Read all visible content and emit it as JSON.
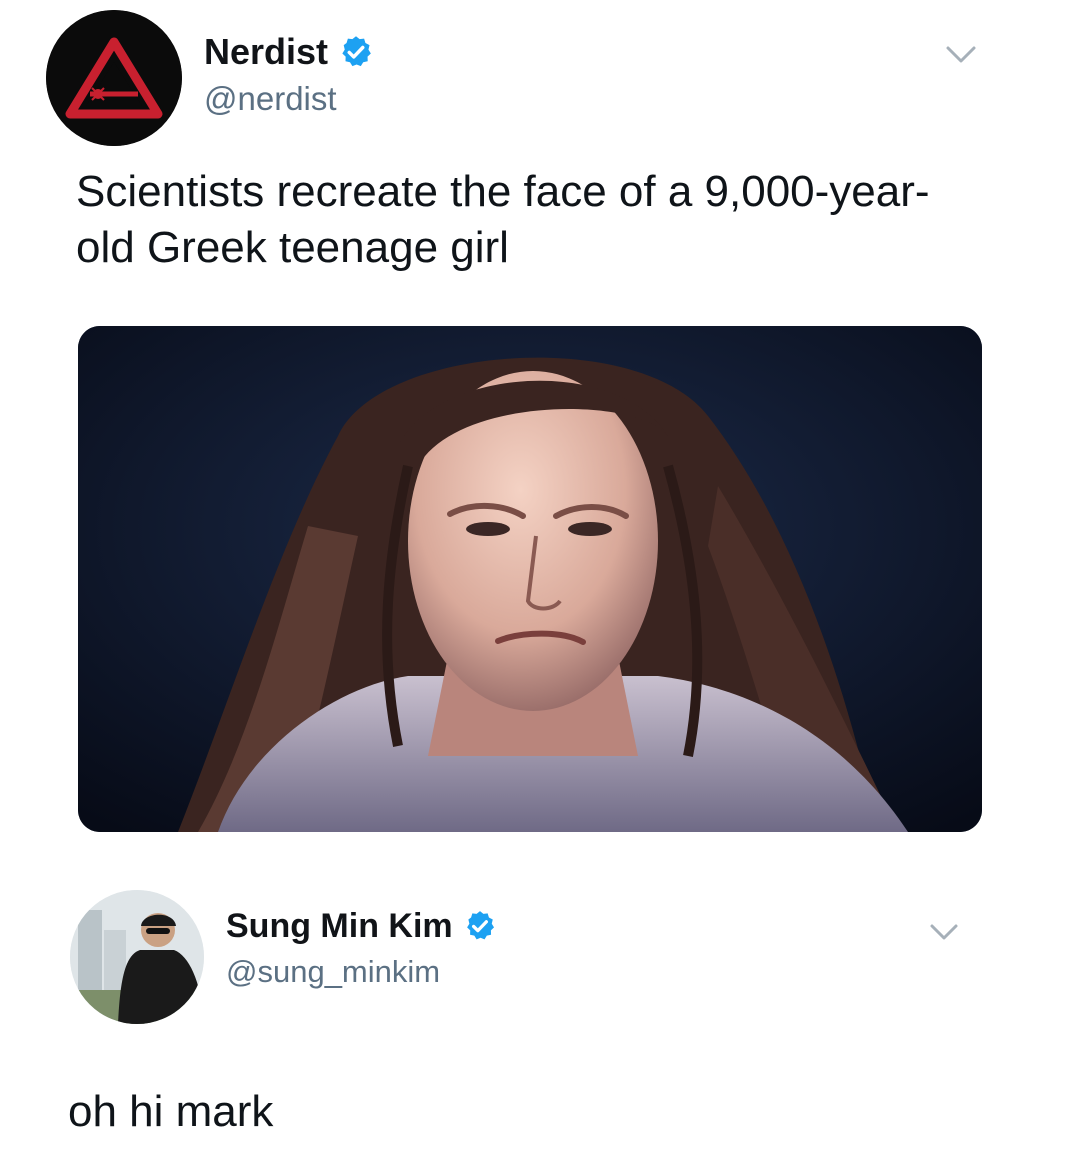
{
  "tweet1": {
    "display_name": "Nerdist",
    "handle": "@nerdist",
    "verified": true,
    "text": "Scientists recreate the face of a 9,000-year-old Greek teenage girl",
    "avatar_icon": "nerdist-logo-icon",
    "menu_icon": "chevron-down-icon",
    "media_description": "reconstructed-face-photo"
  },
  "tweet2": {
    "display_name": "Sung Min Kim",
    "handle": "@sung_minkim",
    "verified": true,
    "text": "oh hi mark",
    "menu_icon": "chevron-down-icon"
  },
  "colors": {
    "verified_blue": "#1da1f2",
    "handle_gray": "#5b7083",
    "logo_red": "#c8202f",
    "media_bg": "#101a2e"
  }
}
